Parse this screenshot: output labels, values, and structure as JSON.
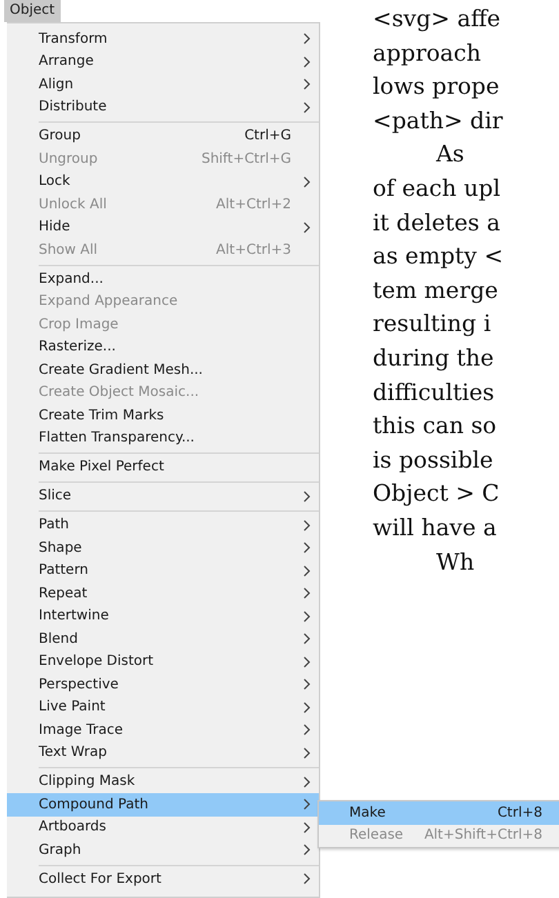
{
  "menu_title": "Object",
  "menu": {
    "sections": [
      [
        {
          "label": "Transform",
          "submenu": true,
          "disabled": false,
          "selected": false
        },
        {
          "label": "Arrange",
          "submenu": true,
          "disabled": false,
          "selected": false
        },
        {
          "label": "Align",
          "submenu": true,
          "disabled": false,
          "selected": false
        },
        {
          "label": "Distribute",
          "submenu": true,
          "disabled": false,
          "selected": false
        }
      ],
      [
        {
          "label": "Group",
          "shortcut": "Ctrl+G",
          "submenu": false,
          "disabled": false,
          "selected": false
        },
        {
          "label": "Ungroup",
          "shortcut": "Shift+Ctrl+G",
          "submenu": false,
          "disabled": true,
          "selected": false
        },
        {
          "label": "Lock",
          "submenu": true,
          "disabled": false,
          "selected": false
        },
        {
          "label": "Unlock All",
          "shortcut": "Alt+Ctrl+2",
          "submenu": false,
          "disabled": true,
          "selected": false
        },
        {
          "label": "Hide",
          "submenu": true,
          "disabled": false,
          "selected": false
        },
        {
          "label": "Show All",
          "shortcut": "Alt+Ctrl+3",
          "submenu": false,
          "disabled": true,
          "selected": false
        }
      ],
      [
        {
          "label": "Expand...",
          "submenu": false,
          "disabled": false,
          "selected": false
        },
        {
          "label": "Expand Appearance",
          "submenu": false,
          "disabled": true,
          "selected": false
        },
        {
          "label": "Crop Image",
          "submenu": false,
          "disabled": true,
          "selected": false
        },
        {
          "label": "Rasterize...",
          "submenu": false,
          "disabled": false,
          "selected": false
        },
        {
          "label": "Create Gradient Mesh...",
          "submenu": false,
          "disabled": false,
          "selected": false
        },
        {
          "label": "Create Object Mosaic...",
          "submenu": false,
          "disabled": true,
          "selected": false
        },
        {
          "label": "Create Trim Marks",
          "submenu": false,
          "disabled": false,
          "selected": false
        },
        {
          "label": "Flatten Transparency...",
          "submenu": false,
          "disabled": false,
          "selected": false
        }
      ],
      [
        {
          "label": "Make Pixel Perfect",
          "submenu": false,
          "disabled": false,
          "selected": false
        }
      ],
      [
        {
          "label": "Slice",
          "submenu": true,
          "disabled": false,
          "selected": false
        }
      ],
      [
        {
          "label": "Path",
          "submenu": true,
          "disabled": false,
          "selected": false
        },
        {
          "label": "Shape",
          "submenu": true,
          "disabled": false,
          "selected": false
        },
        {
          "label": "Pattern",
          "submenu": true,
          "disabled": false,
          "selected": false
        },
        {
          "label": "Repeat",
          "submenu": true,
          "disabled": false,
          "selected": false
        },
        {
          "label": "Intertwine",
          "submenu": true,
          "disabled": false,
          "selected": false
        },
        {
          "label": "Blend",
          "submenu": true,
          "disabled": false,
          "selected": false
        },
        {
          "label": "Envelope Distort",
          "submenu": true,
          "disabled": false,
          "selected": false
        },
        {
          "label": "Perspective",
          "submenu": true,
          "disabled": false,
          "selected": false
        },
        {
          "label": "Live Paint",
          "submenu": true,
          "disabled": false,
          "selected": false
        },
        {
          "label": "Image Trace",
          "submenu": true,
          "disabled": false,
          "selected": false
        },
        {
          "label": "Text Wrap",
          "submenu": true,
          "disabled": false,
          "selected": false
        }
      ],
      [
        {
          "label": "Clipping Mask",
          "submenu": true,
          "disabled": false,
          "selected": false
        },
        {
          "label": "Compound Path",
          "submenu": true,
          "disabled": false,
          "selected": true
        },
        {
          "label": "Artboards",
          "submenu": true,
          "disabled": false,
          "selected": false
        },
        {
          "label": "Graph",
          "submenu": true,
          "disabled": false,
          "selected": false
        }
      ],
      [
        {
          "label": "Collect For Export",
          "submenu": true,
          "disabled": false,
          "selected": false
        }
      ]
    ]
  },
  "submenu": {
    "items": [
      {
        "label": "Make",
        "shortcut": "Ctrl+8",
        "disabled": false,
        "selected": true
      },
      {
        "label": "Release",
        "shortcut": "Alt+Shift+Ctrl+8",
        "disabled": true,
        "selected": false
      }
    ]
  },
  "body_text": {
    "paragraphs": [
      {
        "lines": [
          "<svg> affe",
          "approach",
          "lows prope",
          "<path> dir"
        ]
      },
      {
        "lines": [
          "As",
          "of each upl",
          "it deletes a",
          "as empty <",
          "tem merge",
          "resulting i",
          "during the",
          "difficulties",
          "this can so",
          "is possible",
          "Object > C",
          "will have a"
        ]
      },
      {
        "lines": [
          "Wh"
        ]
      }
    ]
  }
}
